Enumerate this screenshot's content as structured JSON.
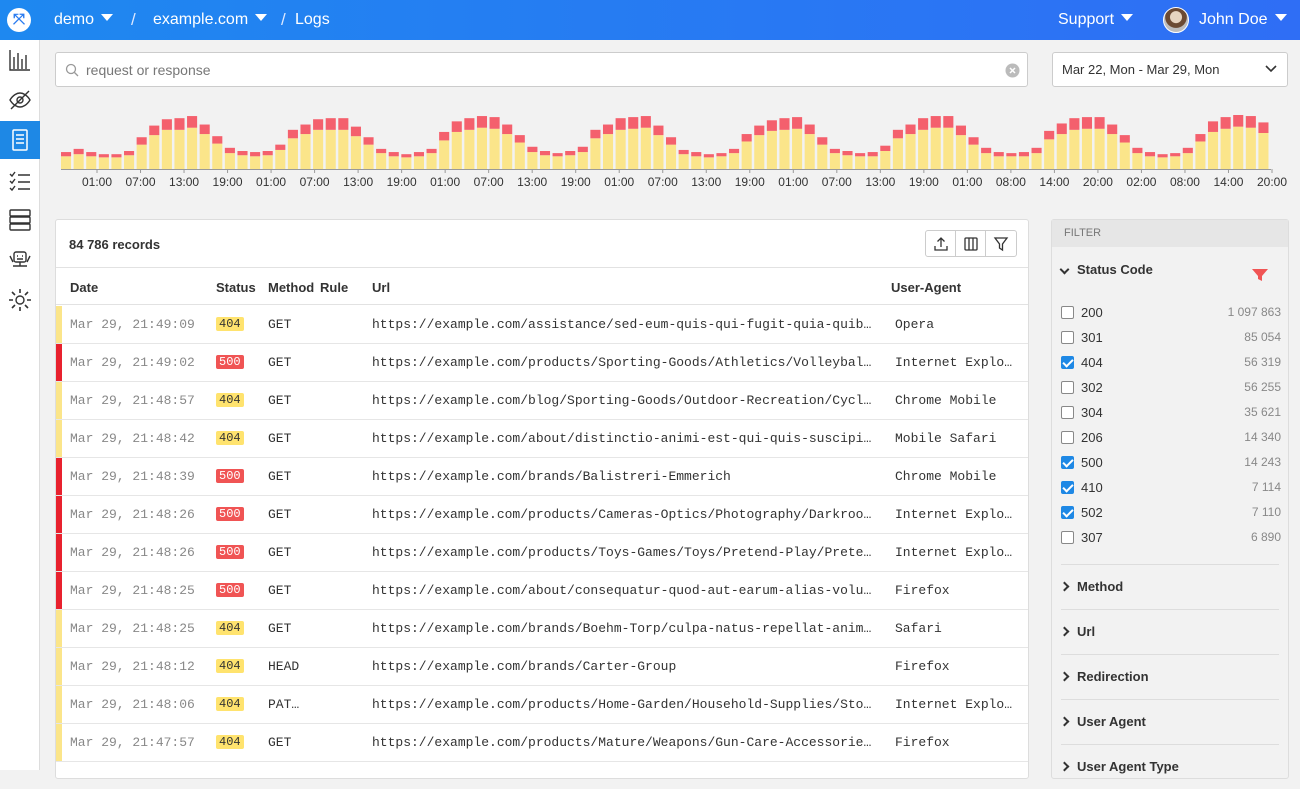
{
  "topbar": {
    "project": "demo",
    "site": "example.com",
    "page": "Logs",
    "support": "Support",
    "user": "John Doe"
  },
  "search": {
    "placeholder": "request or response",
    "value": ""
  },
  "daterange": "Mar 22, Mon - Mar 29, Mon",
  "chart_data": {
    "type": "bar",
    "stacked": true,
    "series_colors": {
      "success": "#fbe58a",
      "errors": "#f4606d"
    },
    "x_tick_labels": [
      "01:00",
      "07:00",
      "13:00",
      "19:00",
      "01:00",
      "07:00",
      "13:00",
      "19:00",
      "01:00",
      "07:00",
      "13:00",
      "19:00",
      "01:00",
      "07:00",
      "13:00",
      "19:00",
      "01:00",
      "07:00",
      "13:00",
      "19:00",
      "01:00",
      "08:00",
      "14:00",
      "20:00",
      "02:00",
      "08:00",
      "14:00",
      "20:00"
    ],
    "totals": [
      16,
      19,
      16,
      14,
      14,
      17,
      30,
      41,
      47,
      48,
      50,
      42,
      31,
      20,
      17,
      16,
      17,
      23,
      37,
      42,
      47,
      48,
      48,
      40,
      30,
      19,
      16,
      14,
      16,
      19,
      35,
      45,
      48,
      50,
      49,
      42,
      32,
      21,
      17,
      15,
      17,
      21,
      37,
      42,
      48,
      49,
      50,
      41,
      30,
      18,
      16,
      14,
      15,
      19,
      33,
      41,
      46,
      48,
      49,
      42,
      30,
      19,
      17,
      15,
      16,
      22,
      37,
      42,
      48,
      50,
      50,
      41,
      30,
      20,
      16,
      15,
      16,
      20,
      36,
      43,
      48,
      49,
      49,
      42,
      32,
      20,
      16,
      14,
      15,
      20,
      33,
      45,
      49,
      51,
      50,
      44
    ],
    "error_values": [
      4,
      5,
      4,
      3,
      3,
      4,
      7,
      9,
      10,
      11,
      11,
      9,
      7,
      5,
      4,
      4,
      4,
      5,
      8,
      9,
      10,
      11,
      11,
      9,
      7,
      4,
      4,
      3,
      4,
      4,
      8,
      10,
      11,
      11,
      11,
      9,
      7,
      5,
      4,
      3,
      4,
      5,
      8,
      9,
      11,
      11,
      11,
      9,
      7,
      4,
      4,
      3,
      3,
      4,
      7,
      9,
      10,
      11,
      11,
      9,
      7,
      4,
      4,
      3,
      4,
      5,
      8,
      9,
      11,
      11,
      11,
      9,
      7,
      5,
      4,
      3,
      4,
      5,
      8,
      10,
      11,
      11,
      11,
      9,
      7,
      5,
      4,
      3,
      3,
      5,
      7,
      10,
      11,
      11,
      11,
      10
    ]
  },
  "table": {
    "records": "84 786 records",
    "columns": {
      "date": "Date",
      "status": "Status",
      "method": "Method",
      "rule": "Rule",
      "url": "Url",
      "ua": "User-Agent"
    },
    "rows": [
      {
        "date": "Mar 29, 21:49:09",
        "status": "404",
        "method": "GET",
        "url": "https://example.com/assistance/sed-eum-quis-qui-fugit-quia-quibusdam-dolores.png",
        "ua": "Opera",
        "color": "#fbe58a"
      },
      {
        "date": "Mar 29, 21:49:02",
        "status": "500",
        "method": "GET",
        "url": "https://example.com/products/Sporting-Goods/Athletics/Volleyball/Volleyball-Nets",
        "ua": "Internet Explorer",
        "color": "#e8212e"
      },
      {
        "date": "Mar 29, 21:48:57",
        "status": "404",
        "method": "GET",
        "url": "https://example.com/blog/Sporting-Goods/Outdoor-Recreation/Cycling/Bicycles",
        "ua": "Chrome Mobile",
        "color": "#fbe58a"
      },
      {
        "date": "Mar 29, 21:48:42",
        "status": "404",
        "method": "GET",
        "url": "https://example.com/about/distinctio-animi-est-qui-quis-suscipit.png",
        "ua": "Mobile Safari",
        "color": "#fbe58a"
      },
      {
        "date": "Mar 29, 21:48:39",
        "status": "500",
        "method": "GET",
        "url": "https://example.com/brands/Balistreri-Emmerich",
        "ua": "Chrome Mobile",
        "color": "#e8212e"
      },
      {
        "date": "Mar 29, 21:48:26",
        "status": "500",
        "method": "GET",
        "url": "https://example.com/products/Cameras-Optics/Photography/Darkroom/Developing-Tanks",
        "ua": "Internet Explorer",
        "color": "#e8212e"
      },
      {
        "date": "Mar 29, 21:48:26",
        "status": "500",
        "method": "GET",
        "url": "https://example.com/products/Toys-Games/Toys/Pretend-Play/Pretend-Shopping",
        "ua": "Internet Explorer",
        "color": "#e8212e"
      },
      {
        "date": "Mar 29, 21:48:25",
        "status": "500",
        "method": "GET",
        "url": "https://example.com/about/consequatur-quod-aut-earum-alias-voluptas.pdf",
        "ua": "Firefox",
        "color": "#e8212e"
      },
      {
        "date": "Mar 29, 21:48:25",
        "status": "404",
        "method": "GET",
        "url": "https://example.com/brands/Boehm-Torp/culpa-natus-repellat-animi-libero",
        "ua": "Safari",
        "color": "#fbe58a"
      },
      {
        "date": "Mar 29, 21:48:12",
        "status": "404",
        "method": "HEAD",
        "url": "https://example.com/brands/Carter-Group",
        "ua": "Firefox",
        "color": "#fbe58a"
      },
      {
        "date": "Mar 29, 21:48:06",
        "status": "404",
        "method": "PAT…",
        "url": "https://example.com/products/Home-Garden/Household-Supplies/Storage-Organization",
        "ua": "Internet Explorer",
        "color": "#fbe58a"
      },
      {
        "date": "Mar 29, 21:47:57",
        "status": "404",
        "method": "GET",
        "url": "https://example.com/products/Mature/Weapons/Gun-Care-Accessories/Gun-Cases",
        "ua": "Firefox",
        "color": "#fbe58a"
      }
    ]
  },
  "filter": {
    "header": "FILTER",
    "status_title": "Status Code",
    "codes": [
      {
        "code": "200",
        "count": "1 097 863",
        "checked": false
      },
      {
        "code": "301",
        "count": "85 054",
        "checked": false
      },
      {
        "code": "404",
        "count": "56 319",
        "checked": true
      },
      {
        "code": "302",
        "count": "56 255",
        "checked": false
      },
      {
        "code": "304",
        "count": "35 621",
        "checked": false
      },
      {
        "code": "206",
        "count": "14 340",
        "checked": false
      },
      {
        "code": "500",
        "count": "14 243",
        "checked": true
      },
      {
        "code": "410",
        "count": "7 114",
        "checked": true
      },
      {
        "code": "502",
        "count": "7 110",
        "checked": true
      },
      {
        "code": "307",
        "count": "6 890",
        "checked": false
      }
    ],
    "sections": [
      "Method",
      "Url",
      "Redirection",
      "User Agent",
      "User Agent Type"
    ]
  }
}
